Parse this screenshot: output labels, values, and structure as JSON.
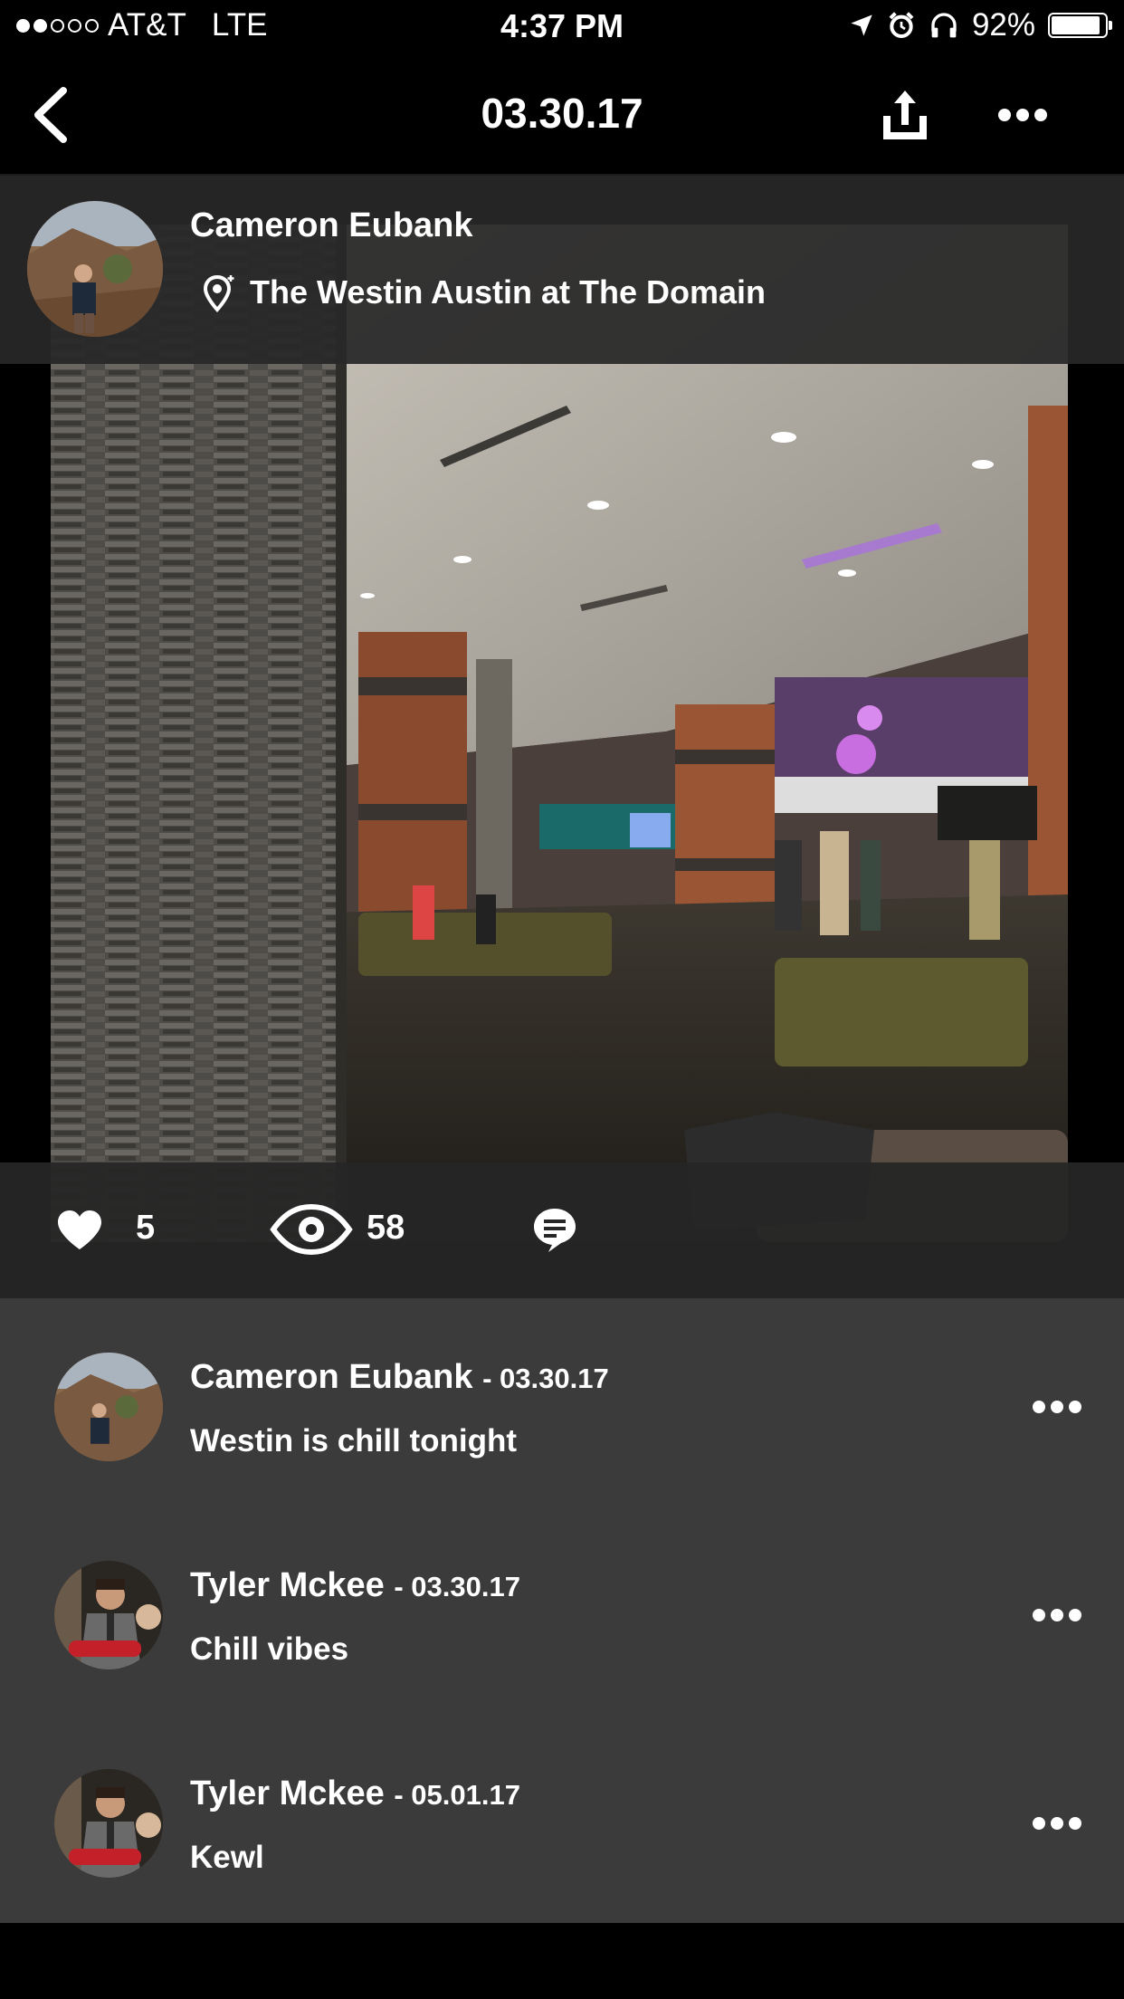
{
  "status_bar": {
    "carrier": "AT&T",
    "network": "LTE",
    "time": "4:37 PM",
    "battery": "92%",
    "battery_level": 0.92,
    "signal_dots_filled": 2,
    "signal_dots_total": 5
  },
  "nav": {
    "title": "03.30.17",
    "back_icon": "chevron-left-icon",
    "share_icon": "share-icon",
    "more_icon": "more-dots-icon"
  },
  "post": {
    "author": "Cameron Eubank",
    "location": "The Westin Austin at The Domain",
    "likes": "5",
    "views": "58"
  },
  "comments": [
    {
      "author": "Cameron Eubank",
      "date": "- 03.30.17",
      "text": "Westin is chill tonight"
    },
    {
      "author": "Tyler Mckee",
      "date": "- 03.30.17",
      "text": "Chill vibes"
    },
    {
      "author": "Tyler Mckee",
      "date": "- 05.01.17",
      "text": "Kewl"
    }
  ],
  "colors": {
    "background": "#000000",
    "comment_panel": "#3b3b3b",
    "overlay_band": "#282828",
    "text": "#ffffff"
  }
}
